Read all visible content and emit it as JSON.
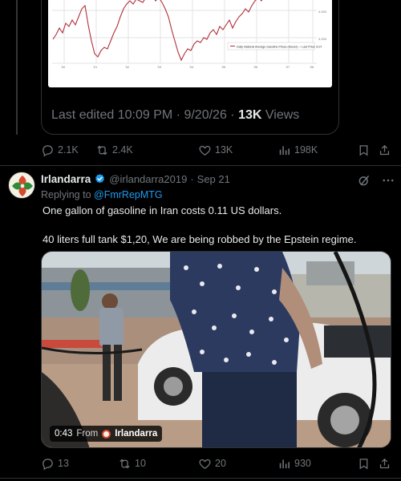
{
  "quoted_post": {
    "edited_label": "Last edited",
    "edited_time": "10:09 PM",
    "edited_date": "9/20/26",
    "separator": "·",
    "views_count": "13K",
    "views_label": "Views",
    "chart_legend": "Daily National Average Gasoline Prices (Diesel) — Last Price: 6.07"
  },
  "top_actions": {
    "replies": "2.1K",
    "reposts": "2.4K",
    "likes": "13K",
    "views": "198K"
  },
  "tweet": {
    "display_name": "Irlandarra",
    "handle": "@irlandarra2019",
    "separator": "·",
    "date": "Sep 21",
    "replying_prefix": "Replying to",
    "replying_mention": "@FmrRepMTG",
    "text": "One gallon of gasoline in Iran costs 0.11 US dollars.\n\n40 liters full tank $1,20,  We are being robbed by the Epstein regime."
  },
  "video": {
    "duration": "0:43",
    "from_label": "From",
    "source_name": "Irlandarra"
  },
  "bottom_actions": {
    "replies": "13",
    "reposts": "10",
    "likes": "20",
    "views": "930"
  },
  "colors": {
    "background": "#000000",
    "text_primary": "#e7e9ea",
    "text_secondary": "#71767b",
    "link": "#1d9bf0",
    "verified": "#1d9bf0",
    "divider": "#2f3336"
  }
}
